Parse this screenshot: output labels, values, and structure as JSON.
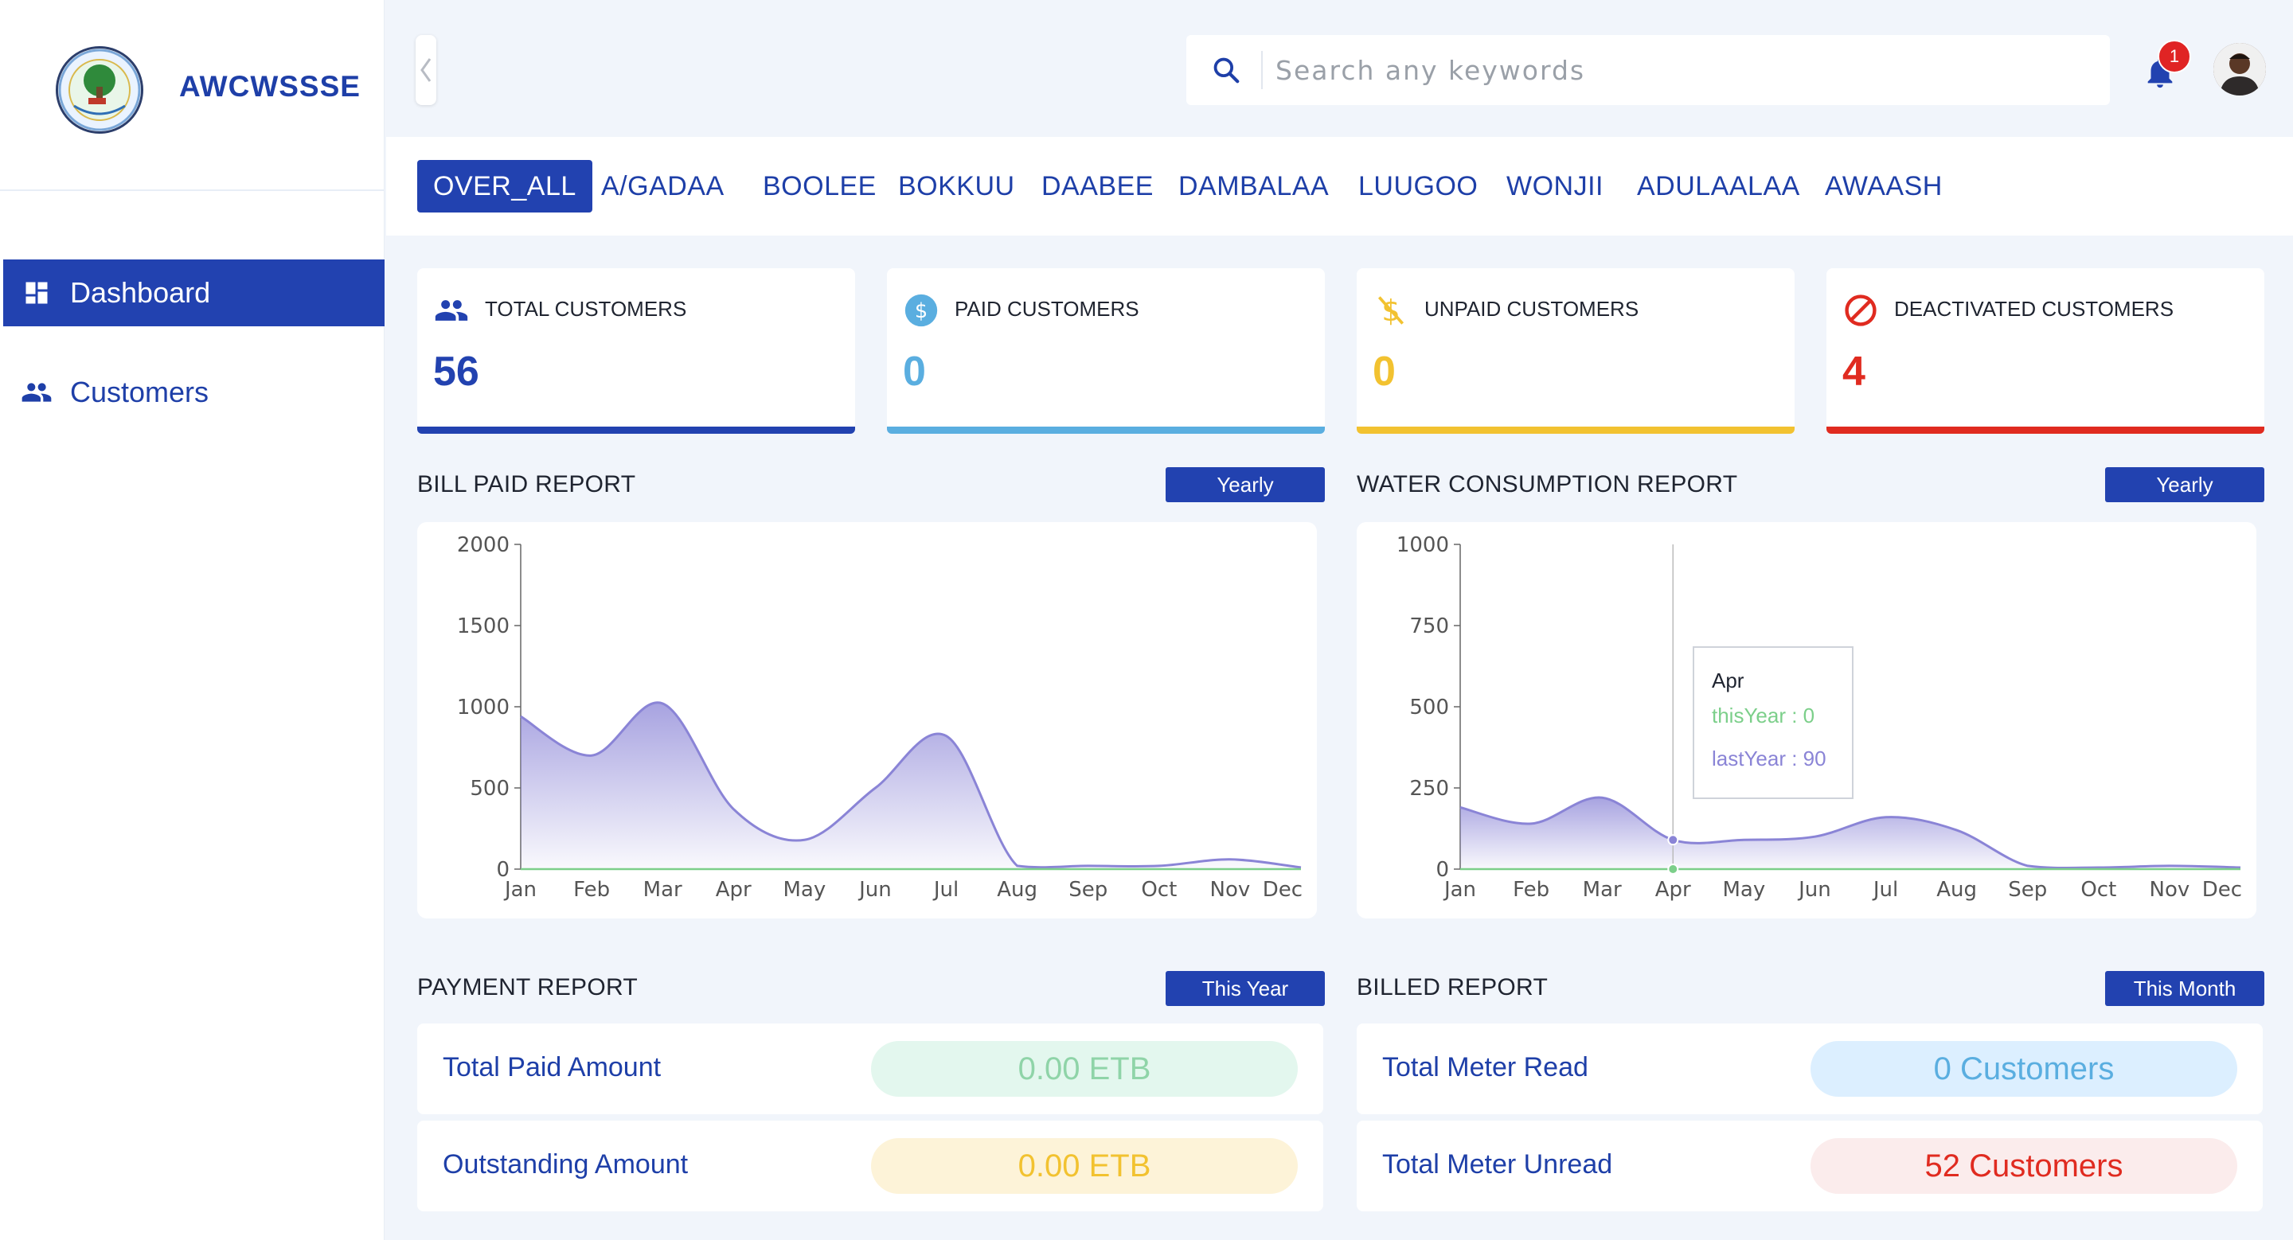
{
  "brand": {
    "name": "AWCWSSSE"
  },
  "sidebar": {
    "items": [
      {
        "label": "Dashboard",
        "icon": "dashboard-icon",
        "active": true
      },
      {
        "label": "Customers",
        "icon": "people-icon",
        "active": false
      }
    ]
  },
  "search": {
    "placeholder": "Search any keywords"
  },
  "notifications": {
    "count": "1"
  },
  "tabs": [
    {
      "label": "OVER_ALL",
      "active": true
    },
    {
      "label": "A/GADAA"
    },
    {
      "label": "BOOLEE"
    },
    {
      "label": "BOKKUU"
    },
    {
      "label": "DAABEE"
    },
    {
      "label": "DAMBALAA"
    },
    {
      "label": "LUUGOO"
    },
    {
      "label": "WONJII"
    },
    {
      "label": "ADULAALAA"
    },
    {
      "label": "AWAASH"
    }
  ],
  "stats": [
    {
      "label": "TOTAL CUSTOMERS",
      "value": "56",
      "color": "#2242b0",
      "icon": "people-icon"
    },
    {
      "label": "PAID CUSTOMERS",
      "value": "0",
      "color": "#5aaee0",
      "icon": "dollar-circle-icon"
    },
    {
      "label": "UNPAID CUSTOMERS",
      "value": "0",
      "color": "#f2c230",
      "icon": "dollar-off-icon"
    },
    {
      "label": "DEACTIVATED CUSTOMERS",
      "value": "4",
      "color": "#e02b20",
      "icon": "block-icon"
    }
  ],
  "bill_report": {
    "title": "BILL PAID REPORT",
    "button": "Yearly"
  },
  "water_report": {
    "title": "WATER CONSUMPTION REPORT",
    "button": "Yearly"
  },
  "payment_report": {
    "title": "PAYMENT REPORT",
    "button": "This Year",
    "rows": [
      {
        "label": "Total Paid Amount",
        "value": "0.00 ETB"
      },
      {
        "label": "Outstanding Amount",
        "value": "0.00 ETB"
      }
    ]
  },
  "billed_report": {
    "title": "BILLED REPORT",
    "button": "This Month",
    "rows": [
      {
        "label": "Total Meter Read",
        "value": "0 Customers"
      },
      {
        "label": "Total Meter Unread",
        "value": "52 Customers"
      }
    ]
  },
  "tooltip": {
    "month": "Apr",
    "this_year": "thisYear : 0",
    "last_year": "lastYear : 90"
  },
  "chart_data": [
    {
      "type": "area",
      "title": "BILL PAID REPORT",
      "x": [
        "Jan",
        "Feb",
        "Mar",
        "Apr",
        "May",
        "Jun",
        "Jul",
        "Aug",
        "Sep",
        "Oct",
        "Nov",
        "Dec"
      ],
      "ylim": [
        0,
        2000
      ],
      "yticks": [
        0,
        500,
        1000,
        1500,
        2000
      ],
      "series": [
        {
          "values": [
            940,
            700,
            1020,
            370,
            180,
            500,
            820,
            20,
            20,
            20,
            60,
            10
          ],
          "color": "#8a84d6"
        },
        {
          "values": [
            0,
            0,
            0,
            0,
            0,
            0,
            0,
            0,
            0,
            0,
            0,
            0
          ],
          "color": "#7ccf8a"
        }
      ]
    },
    {
      "type": "area",
      "title": "WATER CONSUMPTION REPORT",
      "x": [
        "Jan",
        "Feb",
        "Mar",
        "Apr",
        "May",
        "Jun",
        "Jul",
        "Aug",
        "Sep",
        "Oct",
        "Nov",
        "Dec"
      ],
      "ylim": [
        0,
        1000
      ],
      "yticks": [
        0,
        250,
        500,
        750,
        1000
      ],
      "series": [
        {
          "values": [
            190,
            140,
            220,
            90,
            90,
            100,
            160,
            120,
            10,
            5,
            10,
            5
          ],
          "color": "#8a84d6"
        },
        {
          "values": [
            0,
            0,
            0,
            0,
            0,
            0,
            0,
            0,
            0,
            0,
            0,
            0
          ],
          "color": "#7ccf8a"
        }
      ]
    }
  ]
}
